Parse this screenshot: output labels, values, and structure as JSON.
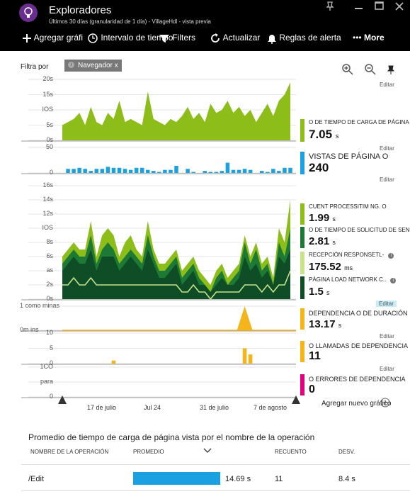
{
  "header": {
    "title": "Exploradores",
    "subtitle": "Últimos 30 días (granularidad de 1 día) - VillageHdl - vista previa",
    "icons": [
      "lightbulb-icon",
      "pin-icon",
      "minimize-icon",
      "maximize-icon",
      "close-icon"
    ]
  },
  "toolbar": {
    "add_chart": "Agregar gráfi",
    "interval": "Intervalo de tiempo",
    "filters": "Filters",
    "refresh": "Actualizar",
    "alerts": "Reglas de alerta",
    "more": "More"
  },
  "filter": {
    "label": "Filtra por",
    "chip": "Navegador x",
    "chip_icon": "i"
  },
  "edit_label": "Editar",
  "add_new_chart": "Agregar nuevo gráfico",
  "colors": {
    "lime": "#8cbd18",
    "blue": "#1ba1e2",
    "dark_green": "#0f4d26",
    "mid_green": "#1c7a35",
    "light_green": "#c8e28a",
    "orange": "#f4b41a",
    "magenta": "#e3007c",
    "header": "#000000"
  },
  "charts": [
    {
      "id": "page-load",
      "ticks": [
        "20s",
        "15s",
        "IOS",
        "5s",
        "0s"
      ],
      "legend": [
        {
          "label": "O DE TIEMPO DE CARGA DE PÁGINA VISTA",
          "value": "7.05",
          "unit": "s",
          "color": "#8cbd18"
        }
      ]
    },
    {
      "id": "page-views",
      "ticks": [
        "50",
        "0"
      ],
      "legend": [
        {
          "label": "VISTAS DE PÁGINA O",
          "value": "240",
          "unit": "",
          "color": "#1ba1e2"
        }
      ]
    },
    {
      "id": "timing",
      "ticks": [
        "16s",
        "14s",
        "12s",
        "IOS",
        "8s",
        "6s",
        "as",
        "2s",
        "0s"
      ],
      "legend": [
        {
          "label": "CUENT PROCESSITIM NG. O",
          "value": "1.99",
          "unit": "s",
          "color": "#8cbd18"
        },
        {
          "label": "O DE TIEMPO DE SOLICITUD DE SENO",
          "value": "2.81",
          "unit": "s",
          "color": "#1c7a35"
        },
        {
          "label": "RECEPCIÓN RESPONSETL-",
          "value": "175.52",
          "unit": "ms",
          "color": "#c8e28a"
        },
        {
          "label": "PÁGINA LOAD NETWORK C..",
          "value": "1.5",
          "unit": "s",
          "color": "#0f4d26"
        }
      ]
    },
    {
      "id": "dependency-duration",
      "ticks": [
        "1 como minas",
        "0m ins"
      ],
      "legend": [
        {
          "label": "DEPENDENCIA O DE DURACIÓN",
          "value": "13.17",
          "unit": "s",
          "color": "#f4b41a"
        }
      ]
    },
    {
      "id": "dependency-calls",
      "ticks": [
        "10",
        "5",
        "0"
      ],
      "legend": [
        {
          "label": "O LLAMADAS DE DEPENDENCIA",
          "value": "11",
          "unit": "",
          "color": "#f4b41a"
        }
      ]
    },
    {
      "id": "dependency-failures",
      "ticks": [
        "1CO",
        "para",
        "0"
      ],
      "legend": [
        {
          "label": "O ERRORES DE DEPENDENCIA",
          "value": "0",
          "unit": "",
          "color": "#e3007c"
        }
      ]
    }
  ],
  "chart_data": [
    {
      "type": "area",
      "series": [
        {
          "name": "O DE TIEMPO DE CARGA DE PÁGINA VISTA",
          "values": [
            5,
            6,
            7,
            9,
            5,
            11,
            6,
            5,
            9,
            7,
            13,
            6,
            7,
            6,
            5,
            16,
            7,
            6,
            5,
            7,
            6,
            8,
            11,
            7,
            9,
            6,
            12,
            9,
            10,
            13,
            9,
            11,
            8,
            10,
            6,
            9,
            12,
            8,
            13,
            15,
            19
          ]
        }
      ]
    },
    {
      "type": "bar",
      "series": [
        {
          "name": "VISTAS DE PÁGINA O",
          "values": [
            0,
            8,
            8,
            10,
            8,
            4,
            8,
            8,
            12,
            10,
            10,
            8,
            6,
            10,
            10,
            6,
            4,
            2,
            6,
            6,
            14,
            0,
            8,
            2,
            0,
            4,
            2,
            2,
            4,
            20,
            6,
            6,
            8,
            6,
            0,
            4,
            2,
            8,
            4,
            10,
            10
          ]
        }
      ]
    },
    {
      "type": "area",
      "series": [
        {
          "name": "CUENT PROCESSITIM NG. O",
          "values": [
            6,
            7,
            8,
            7,
            7,
            11,
            6,
            9,
            10,
            9,
            6,
            8,
            9,
            7,
            6,
            11,
            7,
            5,
            5,
            6,
            7,
            4,
            5,
            6,
            4,
            3,
            2,
            4,
            5,
            3,
            4,
            5,
            9,
            6,
            8,
            5,
            6,
            3,
            10,
            8,
            14
          ]
        },
        {
          "name": "O DE TIEMPO DE SOLICITUD DE SENO",
          "values": [
            5,
            6,
            7,
            6,
            6,
            9,
            5,
            7,
            8,
            7,
            5,
            6,
            7,
            6,
            5,
            9,
            6,
            4,
            4,
            5,
            6,
            3,
            4,
            5,
            3,
            2,
            1,
            3,
            4,
            2,
            3,
            4,
            8,
            5,
            7,
            4,
            5,
            2,
            8,
            6,
            10
          ]
        },
        {
          "name": "RECEPCIÓN RESPONSETL-",
          "values": [
            2,
            2,
            3,
            2,
            2,
            3,
            2,
            2,
            2,
            2,
            2,
            2,
            2,
            2,
            2,
            2,
            2,
            2,
            2,
            2,
            2,
            1,
            1,
            2,
            1,
            1,
            0,
            1,
            1,
            1,
            1,
            1,
            2,
            2,
            2,
            1,
            2,
            1,
            2,
            2,
            4
          ]
        },
        {
          "name": "PÁGINA LOAD NETWORK C..",
          "values": [
            4,
            5,
            6,
            5,
            5,
            7,
            4,
            6,
            6,
            6,
            4,
            5,
            6,
            5,
            4,
            7,
            5,
            3,
            3,
            4,
            5,
            2,
            3,
            4,
            2,
            2,
            1,
            2,
            3,
            2,
            2,
            3,
            6,
            4,
            5,
            3,
            4,
            2,
            6,
            5,
            7
          ]
        }
      ]
    },
    {
      "type": "area",
      "series": [
        {
          "name": "DEPENDENCIA O DE DURACIÓN",
          "values": [
            0,
            0,
            0,
            0,
            0,
            0,
            0,
            0,
            0,
            0,
            0,
            0,
            0,
            0,
            0,
            0,
            0,
            0,
            0,
            0,
            0,
            0,
            0,
            0,
            0,
            0,
            0,
            0,
            0,
            0,
            0,
            0,
            1,
            0,
            0,
            0,
            0,
            0,
            0,
            0,
            0
          ]
        }
      ]
    },
    {
      "type": "bar",
      "series": [
        {
          "name": "O LLAMADAS DE DEPENDENCIA",
          "values": [
            0,
            0,
            0,
            0,
            0,
            0,
            0,
            0,
            0,
            1,
            0,
            0,
            0,
            0,
            0,
            0,
            0,
            0,
            0,
            0,
            0,
            0,
            0,
            0,
            0,
            0,
            0,
            0,
            0,
            0,
            0,
            0,
            5,
            3,
            0,
            0,
            0,
            0,
            0,
            0,
            0
          ]
        }
      ]
    },
    {
      "type": "bar",
      "series": [
        {
          "name": "O ERRORES DE DEPENDENCIA",
          "values": [
            0,
            0,
            0,
            0,
            0,
            0,
            0,
            0,
            0,
            0,
            0,
            0,
            0,
            0,
            0,
            0,
            0,
            0,
            0,
            0,
            0,
            0,
            0,
            0,
            0,
            0,
            0,
            0,
            0,
            0,
            0,
            0,
            0,
            0,
            0,
            0,
            0,
            0,
            0,
            0,
            0
          ]
        }
      ]
    }
  ],
  "x_axis": {
    "labels": [
      "17 de julio",
      "Jul 24",
      "31 de julio",
      "7 de agosto"
    ]
  },
  "table": {
    "title": "Promedio de tiempo de carga de página vista por el nombre de la operación",
    "columns": [
      "NOMBRE DE LA OPERACIÓN",
      "PROMEDIO",
      "RECUENTO",
      "DESV."
    ],
    "rows": [
      {
        "name": "/Edit",
        "avg": "14.69 s",
        "count": "11",
        "stdev": "8.4 s",
        "fraction": 0.82
      }
    ]
  }
}
